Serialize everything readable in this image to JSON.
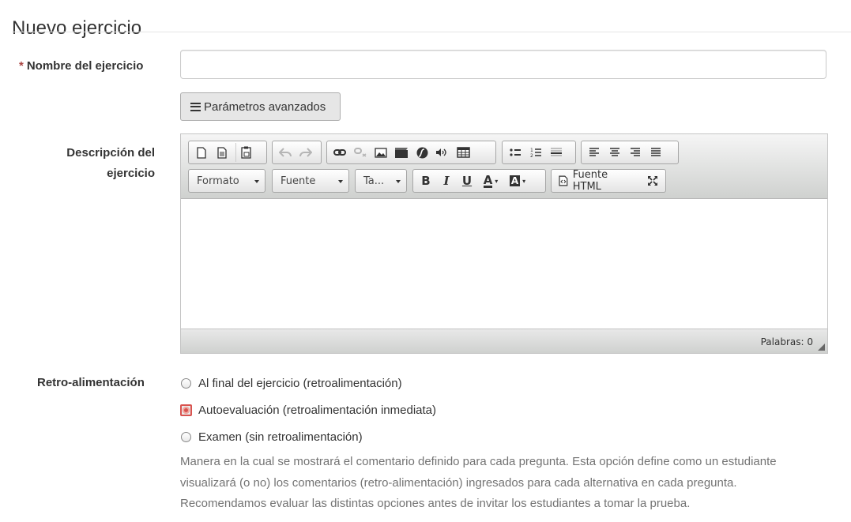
{
  "page": {
    "title": "Nuevo ejercicio"
  },
  "form": {
    "name_label_required_mark": "*",
    "name_label": "Nombre del ejercicio",
    "name_value": "",
    "advanced_button": "Parámetros avanzados",
    "description_label_line1": "Descripción del",
    "description_label_line2": "ejercicio",
    "feedback_label": "Retro-alimentación",
    "feedback_options": [
      {
        "label": "Al final del ejercicio (retroalimentación)",
        "checked": false
      },
      {
        "label": "Autoevaluación (retroalimentación inmediata)",
        "checked": true
      },
      {
        "label": "Examen (sin retroalimentación)",
        "checked": false
      }
    ],
    "feedback_help_lines": [
      "Manera en la cual se mostrará el comentario definido para cada pregunta. Esta opción define como un estudiante",
      "visualizará (o no) los comentarios (retro-alimentación) ingresados para cada alternativa en cada pregunta.",
      "Recomendamos evaluar las distintas opciones antes de invitar los estudiantes a tomar la prueba."
    ]
  },
  "editor": {
    "combo_format": "Formato",
    "combo_font": "Fuente",
    "combo_size": "Ta...",
    "source_button": "Fuente HTML",
    "word_count": "Palabras: 0",
    "icons": {
      "new_page": "new-page-icon",
      "preview": "preview-icon",
      "paste_word": "paste-icon",
      "undo": "undo-icon",
      "redo": "redo-icon",
      "link": "link-icon",
      "unlink": "unlink-icon",
      "image": "image-icon",
      "video": "video-icon",
      "flash": "flash-icon",
      "audio": "audio-icon",
      "table": "table-icon",
      "bullets": "bulleted-list-icon",
      "numbers": "numbered-list-icon",
      "hr": "horizontal-rule-icon",
      "align_left": "align-left-icon",
      "align_center": "align-center-icon",
      "align_right": "align-right-icon",
      "justify": "justify-icon",
      "bold": "B",
      "italic": "I",
      "underline": "U",
      "text_color": "A",
      "bg_color": "A",
      "maximize": "maximize-icon"
    }
  },
  "colors": {
    "required": "#a94442",
    "radio_checked": "#d9534f",
    "help_text": "#737373"
  }
}
